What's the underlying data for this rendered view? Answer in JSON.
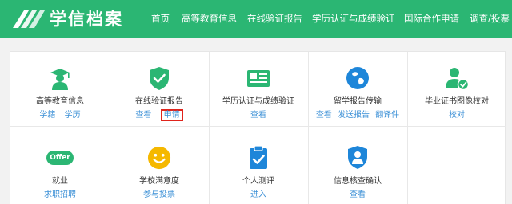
{
  "header": {
    "brand": "学信档案",
    "nav": [
      "首页",
      "高等教育信息",
      "在线验证报告",
      "学历认证与成绩验证",
      "国际合作申请",
      "调查/投票"
    ]
  },
  "services": [
    {
      "title": "高等教育信息",
      "links": [
        "学籍",
        "学历"
      ],
      "icon": "graduate-icon"
    },
    {
      "title": "在线验证报告",
      "links": [
        "查看",
        "申请"
      ],
      "icon": "shield-check-icon"
    },
    {
      "title": "学历认证与成绩验证",
      "links": [
        "查看"
      ],
      "icon": "certificate-card-icon"
    },
    {
      "title": "留学报告传输",
      "links": [
        "查看",
        "发送报告",
        "翻译件"
      ],
      "icon": "globe-icon"
    },
    {
      "title": "毕业证书图像校对",
      "links": [
        "校对"
      ],
      "icon": "user-check-icon"
    },
    {
      "title": "就业",
      "links": [
        "求职招聘"
      ],
      "icon": "offer-icon"
    },
    {
      "title": "学校满意度",
      "links": [
        "参与投票"
      ],
      "icon": "smiley-icon"
    },
    {
      "title": "个人测评",
      "links": [
        "进入"
      ],
      "icon": "clipboard-check-icon"
    },
    {
      "title": "信息核查确认",
      "links": [
        "查看"
      ],
      "icon": "profile-shield-icon"
    }
  ],
  "icon_labels": {
    "offer": "Offer"
  },
  "colors": {
    "brand_green": "#2bb673",
    "link_blue": "#3a8fd6",
    "highlight_red": "#e0241c",
    "smiley_yellow": "#f5b800"
  }
}
